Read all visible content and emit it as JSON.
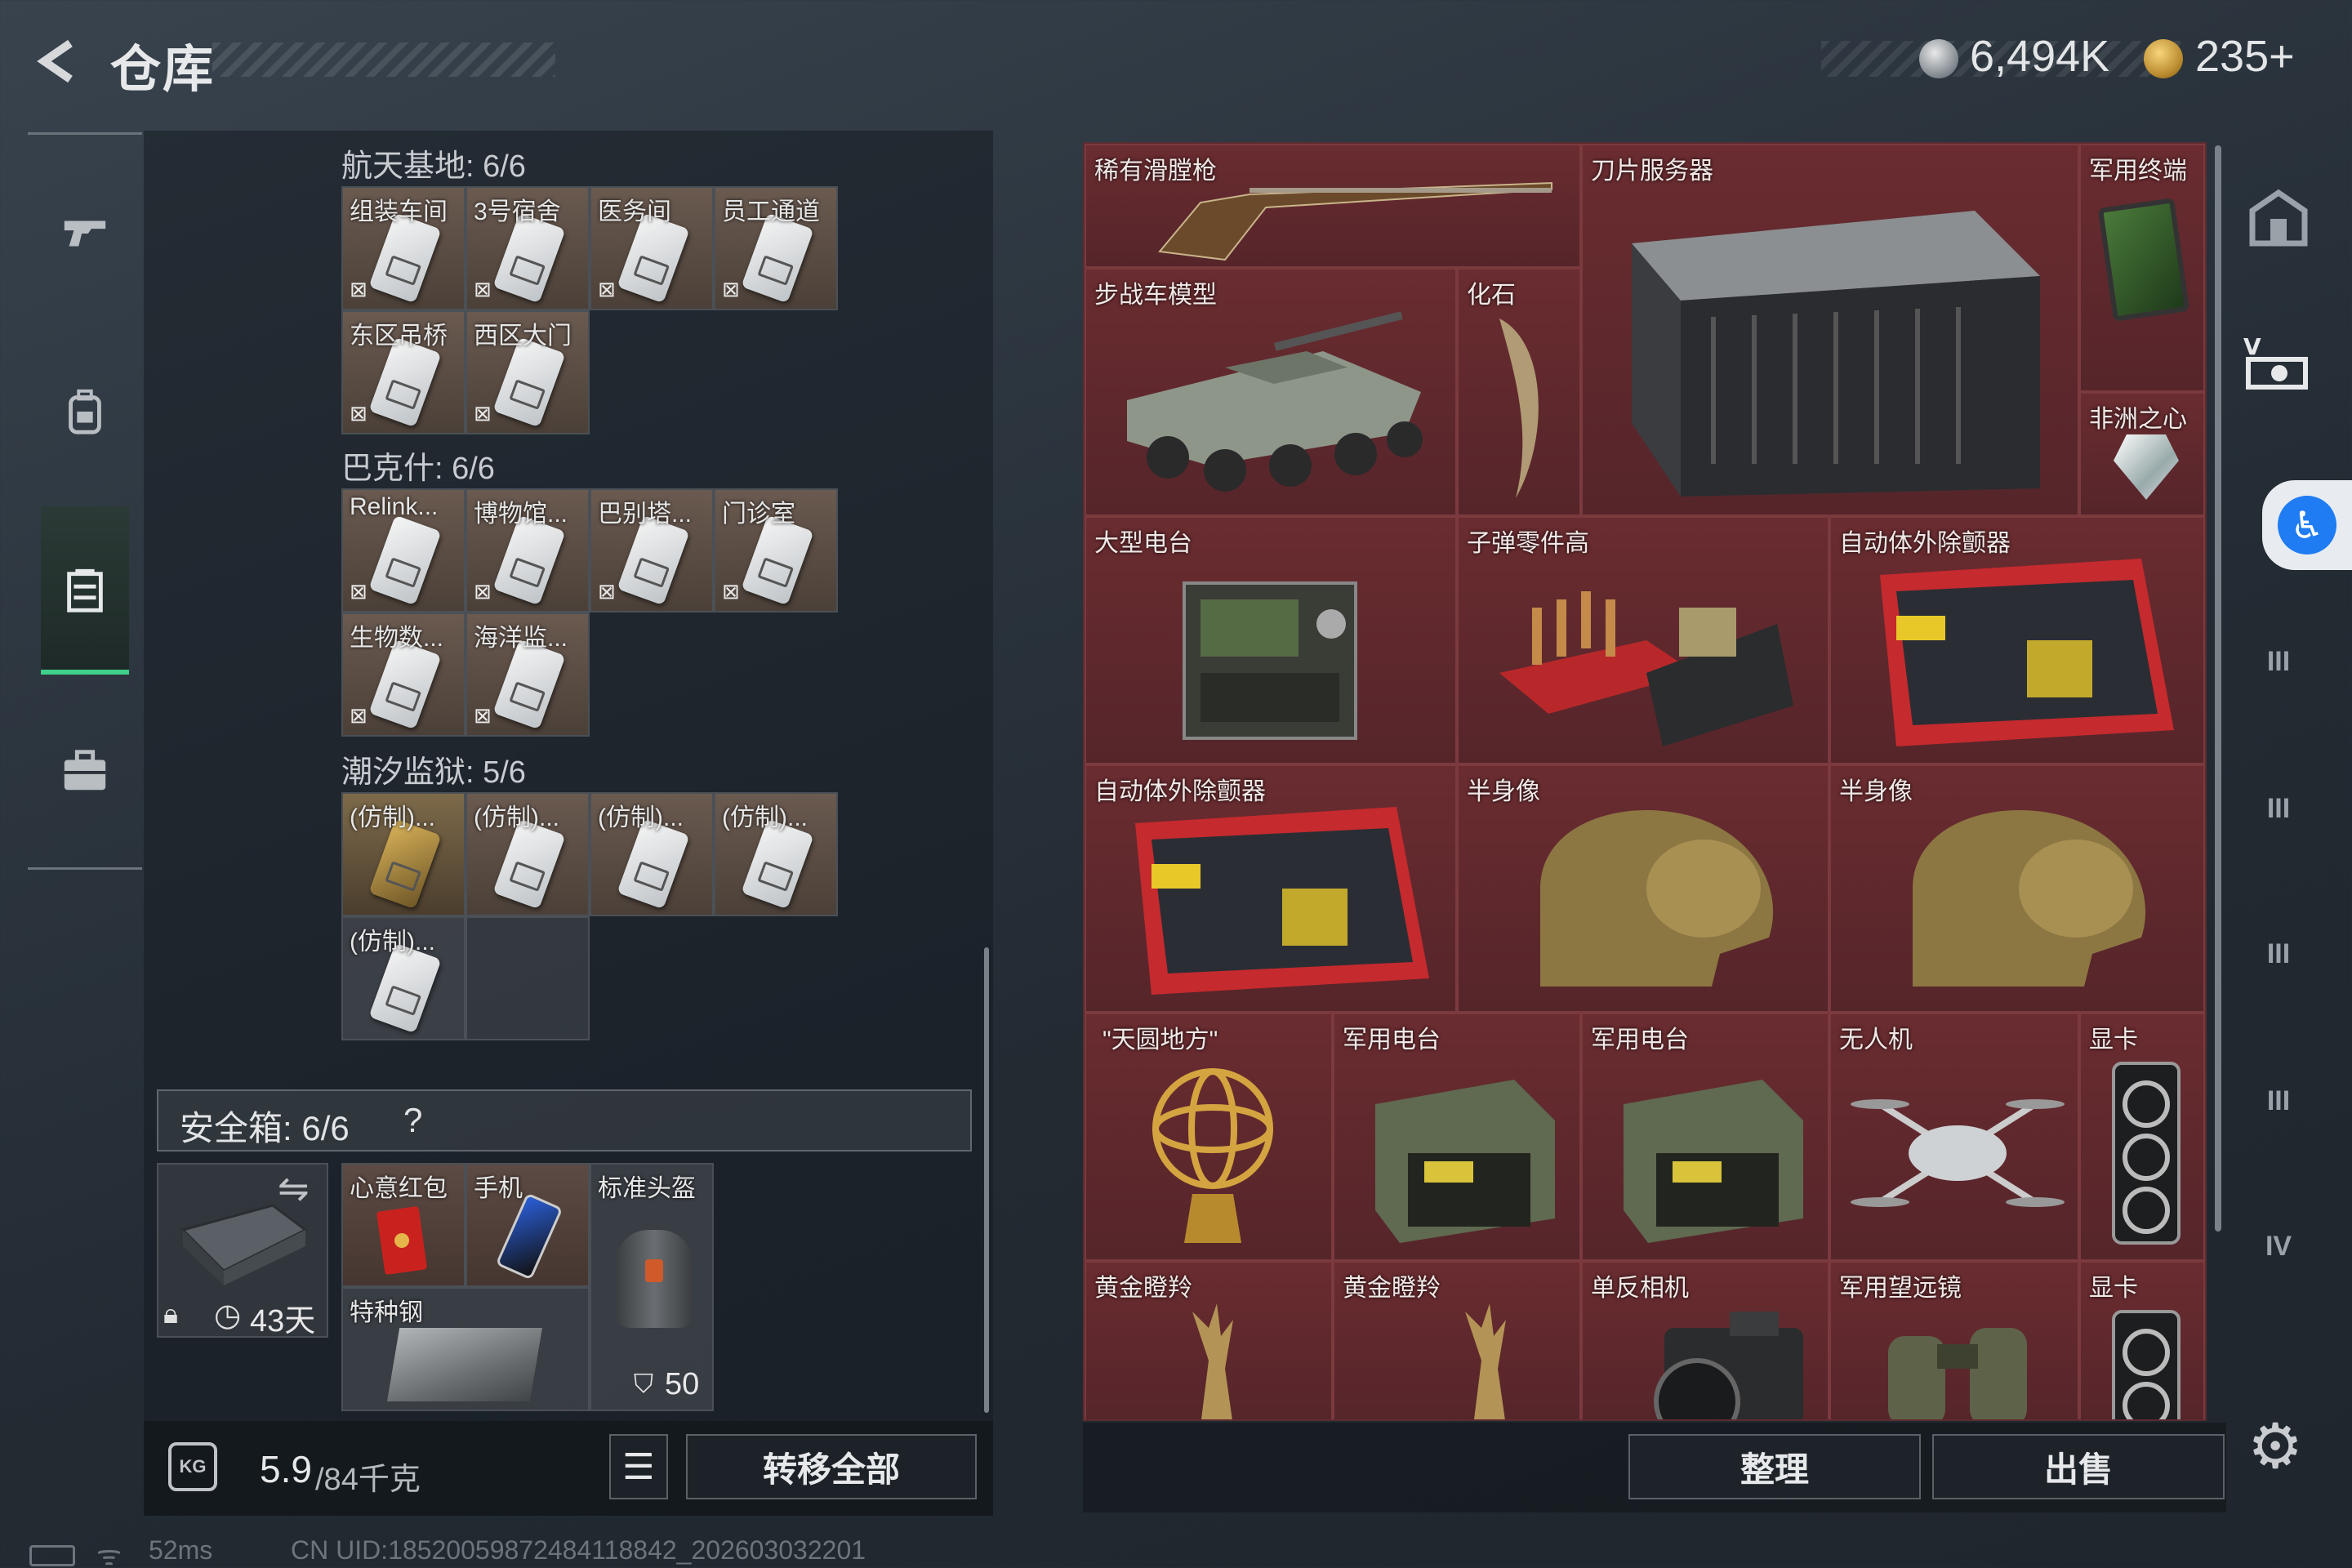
{
  "header": {
    "title": "仓库",
    "currency": [
      {
        "icon": "silver-coin-icon",
        "value": "6,494K"
      },
      {
        "icon": "gold-coin-icon",
        "value": "235+"
      }
    ]
  },
  "stash": {
    "sections": [
      {
        "title": "航天基地: 6/6",
        "items": [
          "组装车间",
          "3号宿舍",
          "医务间",
          "员工通道",
          "东区吊桥",
          "西区大门"
        ]
      },
      {
        "title": "巴克什: 6/6",
        "items": [
          "Relink...",
          "博物馆...",
          "巴别塔...",
          "门诊室",
          "生物数...",
          "海洋监..."
        ]
      },
      {
        "title": "潮汐监狱: 5/6",
        "items": [
          "(仿制)...",
          "(仿制)...",
          "(仿制)...",
          "(仿制)...",
          "(仿制)..."
        ]
      }
    ]
  },
  "safe_box": {
    "title": "安全箱: 6/6",
    "help": "?",
    "days": "43天",
    "items": [
      "心意红包",
      "手机",
      "标准头盔",
      "特种钢"
    ],
    "helmet_durability": "50"
  },
  "weight": {
    "current": "5.9",
    "max": "/84千克",
    "icon": "KG"
  },
  "buttons": {
    "transfer_all": "转移全部",
    "sort": "整理",
    "sell": "出售"
  },
  "grid_items": [
    "稀有滑膛枪",
    "刀片服务器",
    "军用终端",
    "步战车模型",
    "化石",
    "非洲之心",
    "大型电台",
    "子弹零件高",
    "自动体外除颤器",
    "自动体外除颤器",
    "半身像",
    "半身像",
    "\"天圆地方\"",
    "军用电台",
    "军用电台",
    "无人机",
    "显卡",
    "黄金瞪羚",
    "黄金瞪羚",
    "单反相机",
    "军用望远镜",
    "显卡"
  ],
  "right_nav": [
    "IV",
    "III",
    "III",
    "III",
    "III",
    "IV"
  ],
  "status_bar": {
    "ping": "52ms",
    "uid": "CN UID:18520059872484118842_202603032201"
  },
  "colors": {
    "accent_green": "#3fd08a",
    "item_bg": "#6a2c30",
    "access_blue": "#1f7cf2"
  }
}
